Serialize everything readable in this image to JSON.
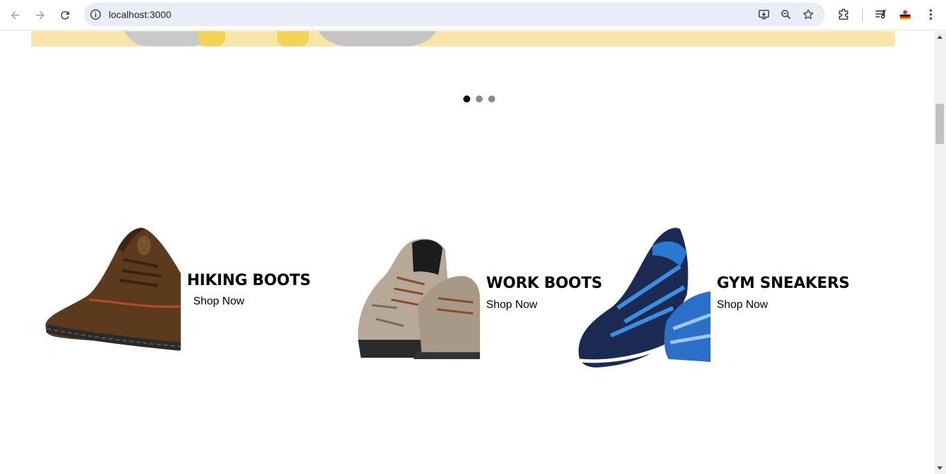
{
  "browser": {
    "url": "localhost:3000",
    "icons": [
      "back-icon",
      "forward-icon",
      "reload-icon",
      "site-info-icon",
      "install-app-icon",
      "zoom-icon",
      "bookmark-star-icon",
      "extensions-icon",
      "reading-list-icon",
      "profile-avatar",
      "menu-kebab-icon"
    ]
  },
  "carousel": {
    "slides": 3,
    "active_index": 0
  },
  "categories": [
    {
      "title": "HIKING BOOTS",
      "link": "Shop Now"
    },
    {
      "title": "WORK BOOTS",
      "link": "Shop Now"
    },
    {
      "title": "GYM SNEAKERS",
      "link": "Shop Now"
    }
  ],
  "colors": {
    "hero_background": "#f7e6a7",
    "dot_active": "#000000",
    "dot_inactive": "#8a8a8a",
    "omnibox": "#e9edf6"
  }
}
